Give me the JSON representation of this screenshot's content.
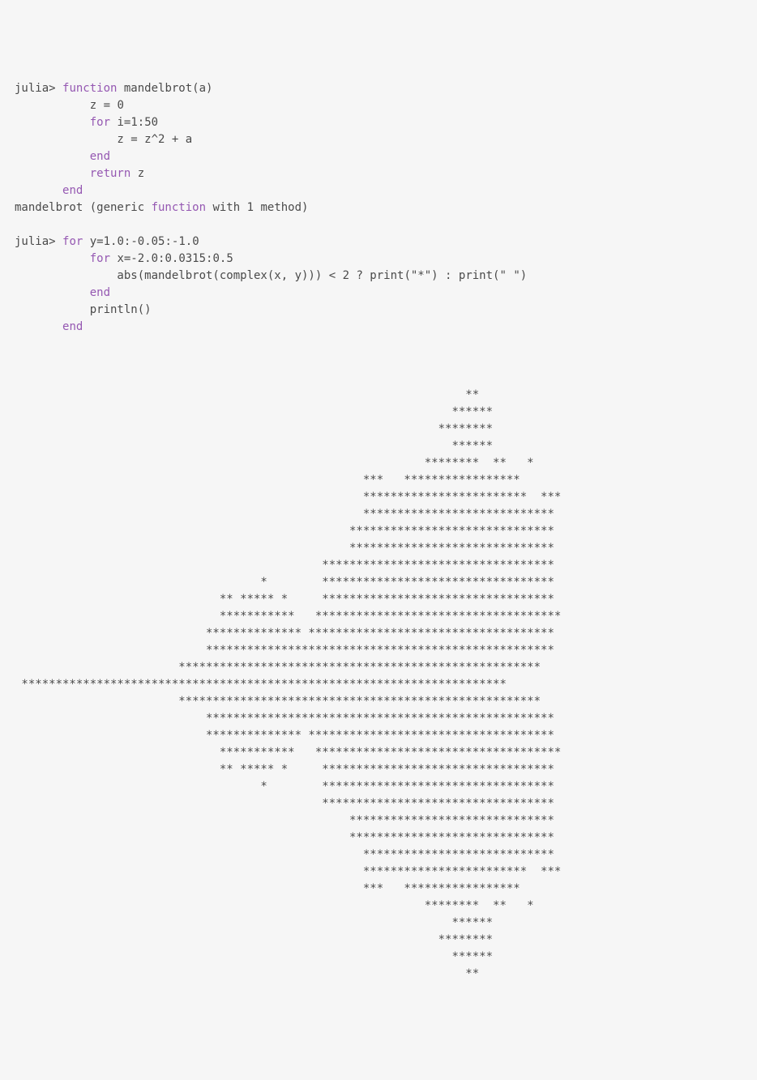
{
  "prompt": "julia>",
  "code1": {
    "l1a": " ",
    "l1b": "function",
    "l1c": " mandelbrot(a)",
    "l2": "           z = ",
    "l2n": "0",
    "l3a": "           ",
    "l3b": "for",
    "l3c": " i=",
    "l3d": "1",
    "l3e": ":",
    "l3f": "50",
    "l4": "               z = z^",
    "l4n": "2",
    "l4o": " + a",
    "l5a": "           ",
    "l5b": "end",
    "l6a": "           ",
    "l6b": "return",
    "l6c": " z",
    "l7a": "       ",
    "l7b": "end",
    "res": "mandelbrot (generic ",
    "res2": "function",
    "res3": " with ",
    "res4": "1",
    "res5": " method)"
  },
  "code2": {
    "l1a": " ",
    "l1b": "for",
    "l1c": " y=",
    "l1d": "1.0",
    "l1e": ":-",
    "l1f": "0.05",
    "l1g": ":-",
    "l1h": "1.0",
    "l2a": "           ",
    "l2b": "for",
    "l2c": " x=-",
    "l2d": "2.0",
    "l2e": ":",
    "l2f": "0.0315",
    "l2g": ":",
    "l2h": "0.5",
    "l3a": "               abs(mandelbrot(complex(x, y))) < ",
    "l3b": "2",
    "l3c": " ? print(",
    "l3d": "\"*\"",
    "l3e": ") : print(",
    "l3f": "\" \"",
    "l3g": ")",
    "l4a": "           ",
    "l4b": "end",
    "l5": "           println()",
    "l6a": "       ",
    "l6b": "end"
  },
  "output": {
    "lines": [
      "                                                                                ",
      "                                                                                ",
      "                                                                                ",
      "                                                                  **            ",
      "                                                                ******          ",
      "                                                              ********          ",
      "                                                                ******          ",
      "                                                            ********  **   *    ",
      "                                                   ***   *****************      ",
      "                                                   ************************  ***",
      "                                                   ****************************  ",
      "                                                 ******************************  ",
      "                                                 ******************************  ",
      "                                             **********************************  ",
      "                                    *        **********************************  ",
      "                              ** ***** *     **********************************  ",
      "                              ***********   ************************************  ",
      "                            ************** ************************************  ",
      "                            ***************************************************  ",
      "                        *****************************************************    ",
      " ***********************************************************************         ",
      "                        *****************************************************    ",
      "                            ***************************************************  ",
      "                            ************** ************************************  ",
      "                              ***********   ************************************  ",
      "                              ** ***** *     **********************************  ",
      "                                    *        **********************************  ",
      "                                             **********************************  ",
      "                                                 ******************************  ",
      "                                                 ******************************  ",
      "                                                   ****************************  ",
      "                                                   ************************  ***",
      "                                                   ***   *****************      ",
      "                                                            ********  **   *    ",
      "                                                                ******          ",
      "                                                              ********          ",
      "                                                                ******          ",
      "                                                                  **            "
    ]
  }
}
